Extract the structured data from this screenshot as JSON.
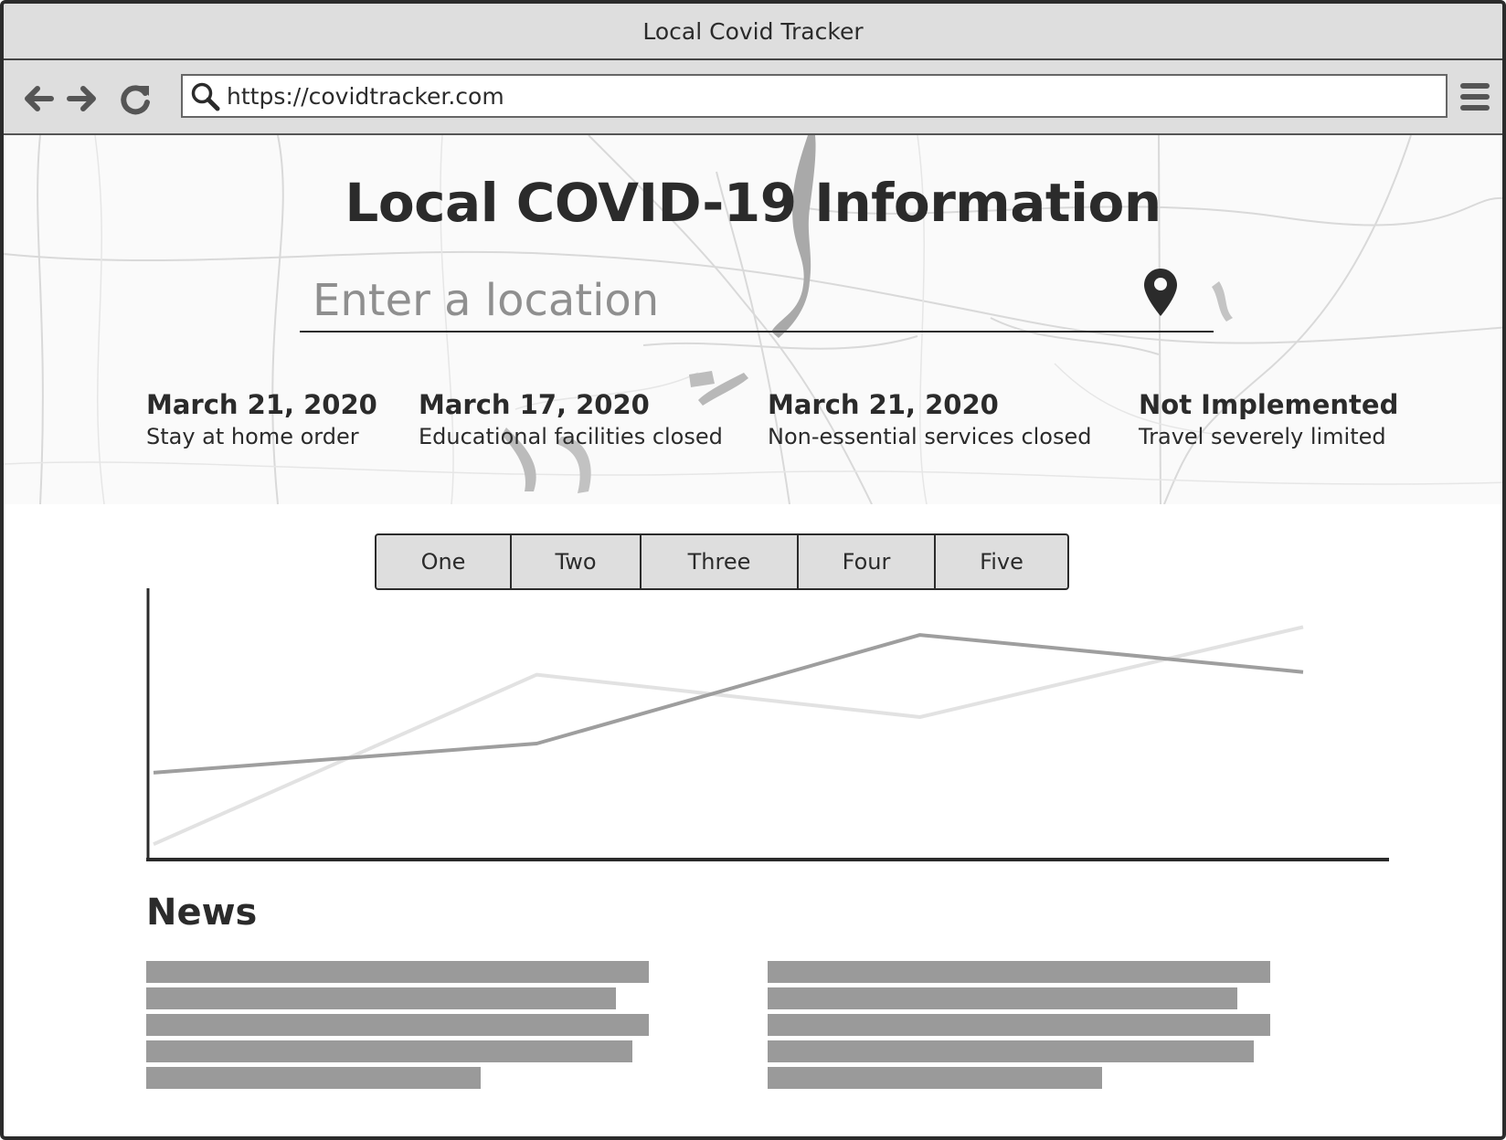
{
  "window": {
    "title": "Local Covid Tracker"
  },
  "browser": {
    "url": "https://covidtracker.com",
    "back_icon": "arrow-left-icon",
    "forward_icon": "arrow-right-icon",
    "reload_icon": "reload-icon",
    "menu_icon": "hamburger-menu-icon"
  },
  "hero": {
    "title": "Local COVID-19 Information",
    "location_placeholder": "Enter a location",
    "pin_icon": "map-pin-icon",
    "stats": [
      {
        "date": "March 21, 2020",
        "desc": "Stay at home order"
      },
      {
        "date": "March 17, 2020",
        "desc": "Educational facilities closed"
      },
      {
        "date": "March 21, 2020",
        "desc": "Non-essential services closed"
      },
      {
        "date": "Not Implemented",
        "desc": "Travel severely limited"
      }
    ]
  },
  "tabs": [
    "One",
    "Two",
    "Three",
    "Four",
    "Five"
  ],
  "chart_data": {
    "type": "line",
    "title": "",
    "xlabel": "",
    "ylabel": "",
    "x": [
      0,
      1,
      2,
      3
    ],
    "ylim": [
      0,
      10
    ],
    "grid": false,
    "series": [
      {
        "values": [
          2.9,
          4.0,
          8.1,
          6.7
        ],
        "color": "#9e9e9e"
      },
      {
        "values": [
          0.2,
          6.6,
          5.0,
          8.4
        ],
        "color": "#e2e2e2"
      }
    ]
  },
  "news": {
    "title": "News"
  },
  "colors": {
    "chrome": "#dedede",
    "text": "#2b2b2b",
    "placeholder": "#8f8f8f",
    "news_bar": "#9a9a9a"
  }
}
